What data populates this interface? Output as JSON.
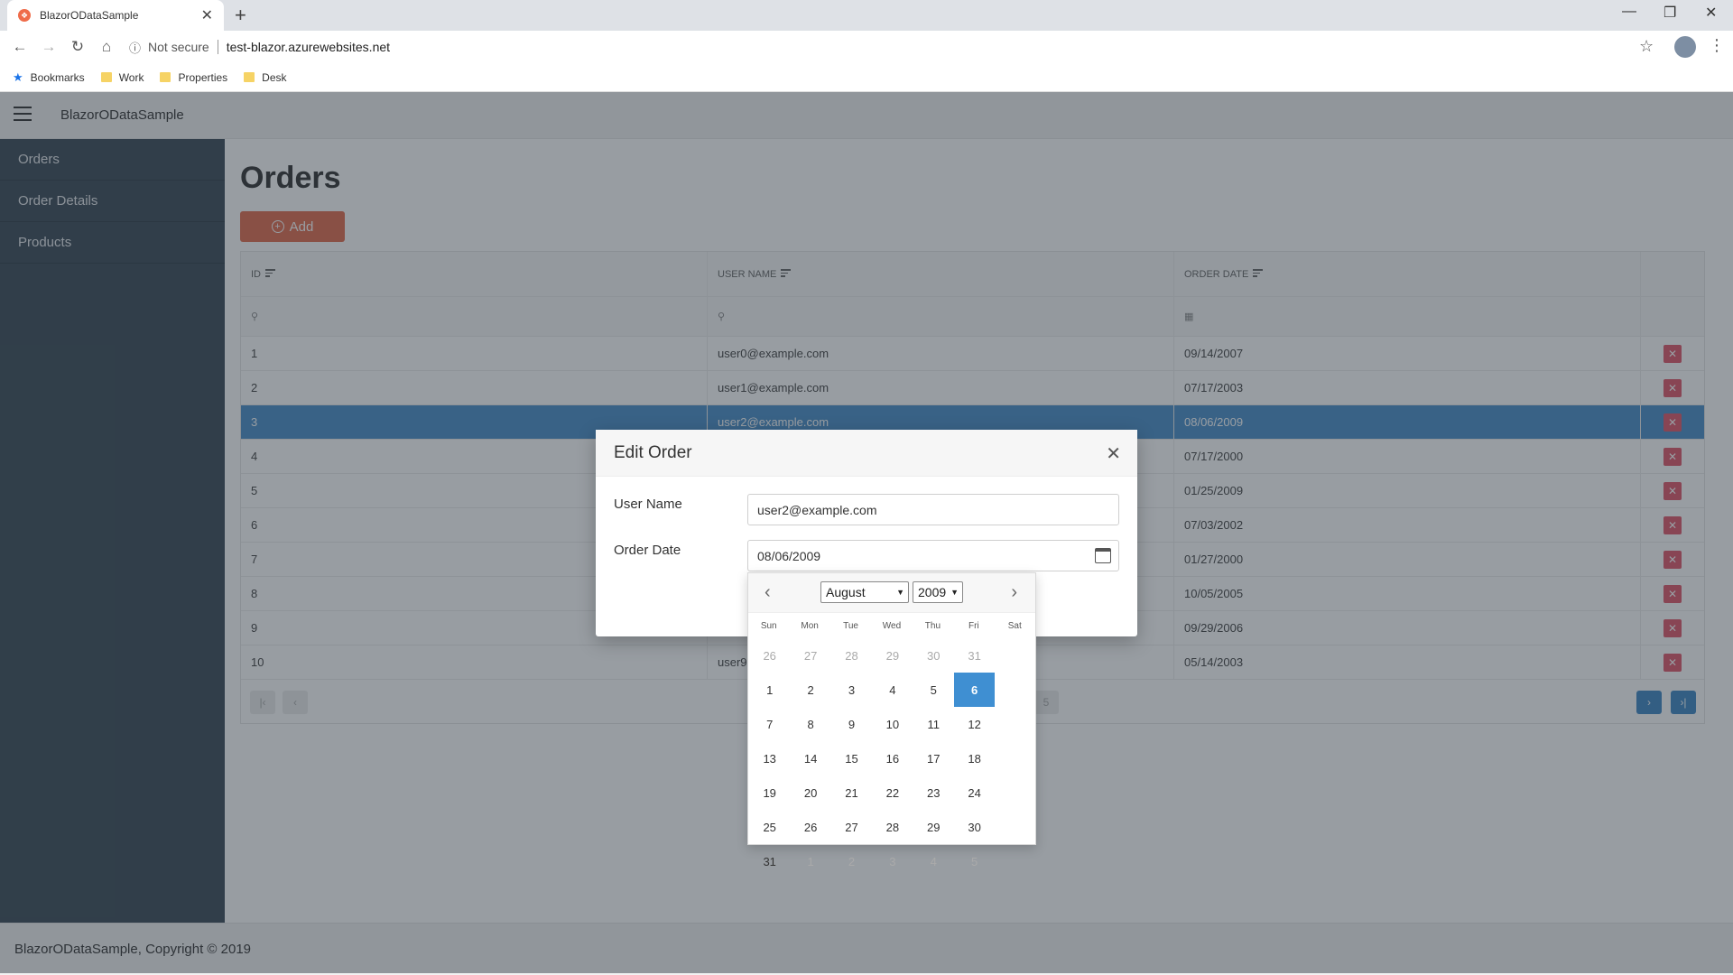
{
  "browser": {
    "tab_title": "BlazorODataSample",
    "new_tab": "+",
    "not_secure": "Not secure",
    "url": "test-blazor.azurewebsites.net",
    "bookmarks": [
      "Bookmarks",
      "Work",
      "Properties",
      "Desk"
    ]
  },
  "app": {
    "title": "BlazorODataSample",
    "sidebar": [
      "Orders",
      "Order Details",
      "Products"
    ],
    "page_title": "Orders",
    "add_label": "Add",
    "columns": [
      "ID",
      "USER NAME",
      "ORDER DATE"
    ],
    "rows": [
      {
        "id": "1",
        "user": "user0@example.com",
        "date": "09/14/2007"
      },
      {
        "id": "2",
        "user": "user1@example.com",
        "date": "07/17/2003"
      },
      {
        "id": "3",
        "user": "user2@example.com",
        "date": "08/06/2009"
      },
      {
        "id": "4",
        "user": "",
        "date": "07/17/2000"
      },
      {
        "id": "5",
        "user": "",
        "date": "01/25/2009"
      },
      {
        "id": "6",
        "user": "",
        "date": "07/03/2002"
      },
      {
        "id": "7",
        "user": "",
        "date": "01/27/2000"
      },
      {
        "id": "8",
        "user": "",
        "date": "10/05/2005"
      },
      {
        "id": "9",
        "user": "",
        "date": "09/29/2006"
      },
      {
        "id": "10",
        "user": "user9",
        "date": "05/14/2003"
      }
    ],
    "selected_row": 3,
    "pager_visible_page": "5",
    "footer": "BlazorODataSample, Copyright © 2019"
  },
  "dialog": {
    "title": "Edit Order",
    "user_label": "User Name",
    "user_value": "user2@example.com",
    "date_label": "Order Date",
    "date_value": "08/06/2009"
  },
  "datepicker": {
    "month": "August",
    "year": "2009",
    "weekdays": [
      "Sun",
      "Mon",
      "Tue",
      "Wed",
      "Thu",
      "Fri",
      "Sat"
    ],
    "days": [
      "26",
      "27",
      "28",
      "29",
      "30",
      "31",
      "1",
      "2",
      "3",
      "4",
      "5",
      "6",
      "7",
      "8",
      "9",
      "10",
      "11",
      "12",
      "13",
      "14",
      "15",
      "16",
      "17",
      "18",
      "19",
      "20",
      "21",
      "22",
      "23",
      "24",
      "25",
      "26",
      "27",
      "28",
      "29",
      "30",
      "31",
      "1",
      "2",
      "3",
      "4",
      "5"
    ],
    "leading_other": 6,
    "trailing_other": 5,
    "selected_day": "6"
  },
  "icons": {
    "delete": "close-icon",
    "calendar": "calendar-icon",
    "search": "search-icon"
  },
  "colors": {
    "accent": "#e26b4d",
    "selected_row": "#4a8fc9",
    "sidebar": "#3a4a57",
    "delete": "#e0566a"
  }
}
